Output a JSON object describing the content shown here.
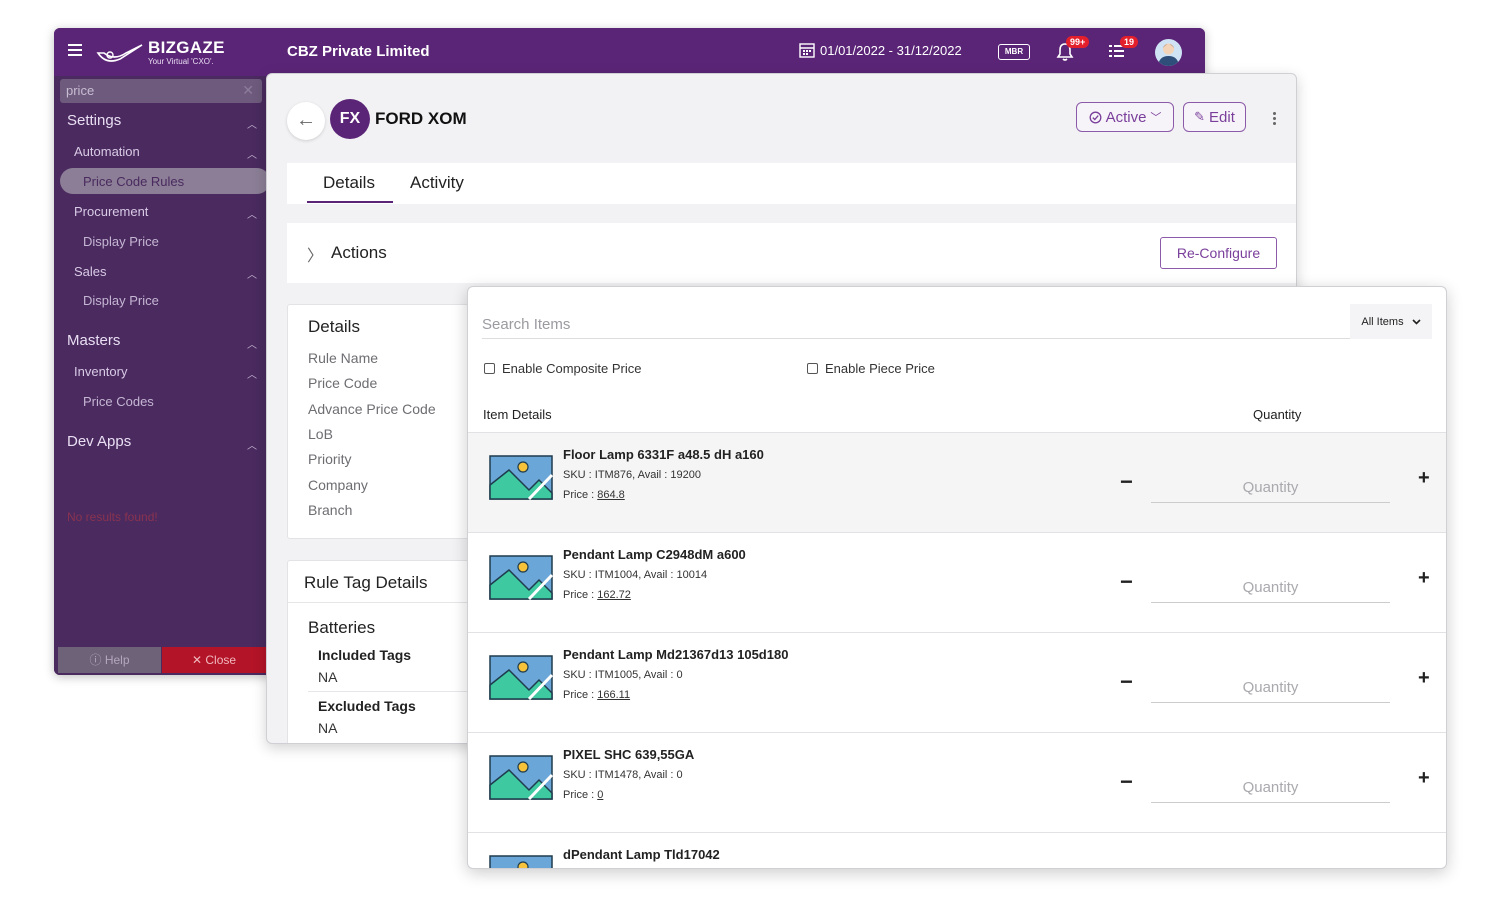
{
  "topbar": {
    "brand": "BIZGAZE",
    "brand_tagline": "Your Virtual 'CXO'.",
    "company": "CBZ Private Limited",
    "date_range": "01/01/2022 - 31/12/2022",
    "mbr_label": "MBR",
    "notifications_count": "99+",
    "tasks_count": "19"
  },
  "sidebar": {
    "search_value": "price",
    "settings": "Settings",
    "automation": "Automation",
    "price_code_rules": "Price Code Rules",
    "procurement": "Procurement",
    "display_price_1": "Display Price",
    "sales": "Sales",
    "display_price_2": "Display Price",
    "masters": "Masters",
    "inventory": "Inventory",
    "price_codes": "Price Codes",
    "dev_apps": "Dev Apps",
    "no_results": "No results found!",
    "help": "Help",
    "close": "Close"
  },
  "record": {
    "initials": "FX",
    "title": "FORD XOM",
    "status_label": "Active",
    "edit_label": "Edit",
    "tabs": [
      {
        "label": "Details"
      },
      {
        "label": "Activity"
      }
    ],
    "actions_label": "Actions",
    "reconfigure_label": "Re-Configure",
    "details_heading": "Details",
    "detail_fields": [
      "Rule Name",
      "Price Code",
      "Advance Price Code",
      "LoB",
      "Priority",
      "Company",
      "Branch"
    ],
    "tag_heading": "Rule Tag Details",
    "tag_group": "Batteries",
    "included_label": "Included Tags",
    "included_value": "NA",
    "excluded_label": "Excluded Tags",
    "excluded_value": "NA"
  },
  "popup": {
    "search_placeholder": "Search Items",
    "filter_value": "All Items",
    "composite_label": "Enable Composite Price",
    "piece_label": "Enable Piece Price",
    "col_item_details": "Item Details",
    "col_quantity": "Quantity",
    "qty_placeholder": "Quantity",
    "items": [
      {
        "name": "Floor Lamp 6331F a48.5 dH a160",
        "sku": "SKU : ITM876, Avail : 19200",
        "price_label": "Price : ",
        "price": "864.8"
      },
      {
        "name": "Pendant Lamp C2948dM a600",
        "sku": "SKU : ITM1004, Avail : 10014",
        "price_label": "Price : ",
        "price": "162.72"
      },
      {
        "name": "Pendant Lamp Md21367d13 105d180",
        "sku": "SKU : ITM1005, Avail : 0",
        "price_label": "Price : ",
        "price": "166.11"
      },
      {
        "name": "PIXEL SHC 639,55GA",
        "sku": "SKU : ITM1478, Avail : 0",
        "price_label": "Price : ",
        "price": "0"
      },
      {
        "name": "dPendant Lamp Tld17042",
        "sku": "",
        "price_label": "",
        "price": ""
      }
    ]
  }
}
